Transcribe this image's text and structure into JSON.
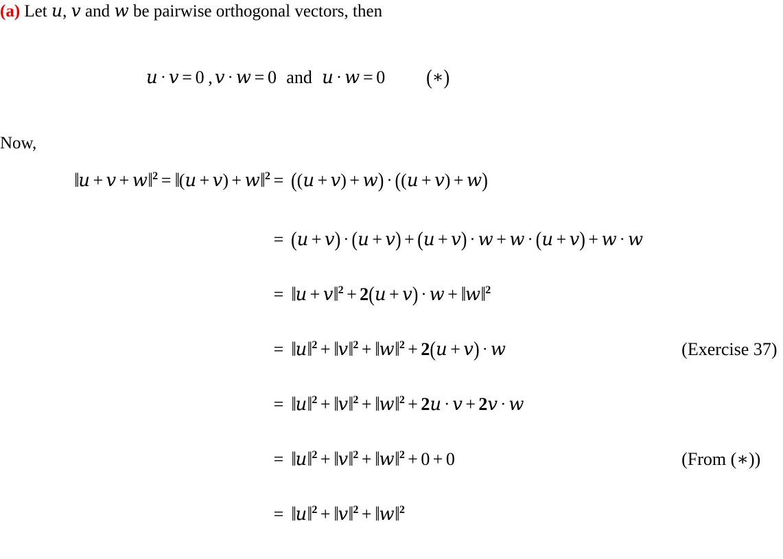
{
  "document": {
    "part_label": "(a)",
    "part_label_color": "#ee0000",
    "intro_text_1": " Let ",
    "intro_var_u": "u",
    "intro_sep_1": ", ",
    "intro_var_v": "v",
    "intro_sep_2": " and ",
    "intro_var_w": "w",
    "intro_text_2": " be pairwise orthogonal vectors, then",
    "now_text": "Now,"
  },
  "star_equation": {
    "eq1_lhs_a": "u",
    "eq1_dot": "·",
    "eq1_lhs_b": "v",
    "eq1_equals": "=",
    "eq1_rhs": "0",
    "comma": ",",
    "eq2_lhs_a": "v",
    "eq2_dot": "·",
    "eq2_lhs_b": "w",
    "eq2_equals": "=",
    "eq2_rhs": "0",
    "and_word": "and",
    "eq3_lhs_a": "u",
    "eq3_dot": "·",
    "eq3_lhs_b": "w",
    "eq3_equals": "=",
    "eq3_rhs": "0",
    "tag_open": "(",
    "tag_star": "∗",
    "tag_close": ")",
    "plain_text": "u · v = 0 , v · w = 0  and  u · w = 0      (∗)"
  },
  "derivation": {
    "rows": [
      {
        "lhs_plain": "‖u + v + w‖2 = ‖(u + v) + w‖2 =",
        "rhs_plain": "((u + v) + w) · ((u + v) + w)",
        "note": ""
      },
      {
        "lhs_plain": "=",
        "rhs_plain": "(u + v) · (u + v) + (u + v) · w + w · (u + v) + w · w",
        "note": ""
      },
      {
        "lhs_plain": "=",
        "rhs_plain": "‖u + v‖2 + 2(u + v) · w + ‖w‖2",
        "note": ""
      },
      {
        "lhs_plain": "=",
        "rhs_plain": "‖u‖2 + ‖v‖2 + ‖w‖2 + 2(u + v) · w",
        "note": "(Exercise 37)"
      },
      {
        "lhs_plain": "=",
        "rhs_plain": "‖u‖2 + ‖v‖2 + ‖w‖2 + 2u · v + 2v · w",
        "note": ""
      },
      {
        "lhs_plain": "=",
        "rhs_plain": "‖u‖2 + ‖v‖2 + ‖w‖2 + 0 + 0",
        "note": "(From (∗))"
      },
      {
        "lhs_plain": "=",
        "rhs_plain": "‖u‖2 + ‖v‖2 + ‖w‖2",
        "note": ""
      }
    ],
    "note_exercise": "(Exercise 37)",
    "note_from_star": "(From (∗))"
  },
  "symbols": {
    "norm_bar": "‖",
    "dot": "·",
    "plus": "+",
    "equals": "=",
    "asterisk": "∗",
    "exponent_two": "2",
    "zero": "0",
    "two": "2",
    "paren_open": "(",
    "paren_close": ")"
  },
  "variables": {
    "u": "u",
    "v": "v",
    "w": "w"
  }
}
